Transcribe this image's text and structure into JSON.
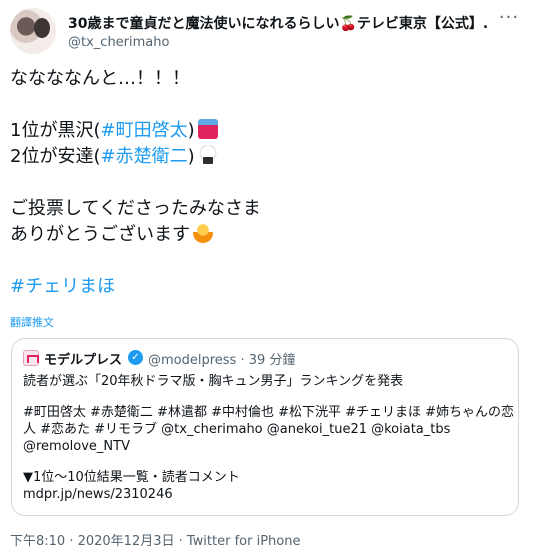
{
  "header": {
    "display_name": "30歳まで童貞だと魔法使いになれるらしい🍒テレビ東京【公式】...",
    "handle": "@tx_cherimaho",
    "more_icon": "more-horizontal-icon"
  },
  "tweet": {
    "line1": "ななななんと…！！！",
    "rank1_prefix": "1位が黒沢(",
    "rank1_hashtag": "#町田啓太",
    "rank1_suffix": ")",
    "rank2_prefix": "2位が安達(",
    "rank2_hashtag": "#赤楚衛二",
    "rank2_suffix": ")",
    "thanks1": "ご投票してくださったみなさま",
    "thanks2": "ありがとうございます",
    "hashtag": "#チェリまほ"
  },
  "translate_label": "翻譯推文",
  "quote": {
    "name": "モデルプレス",
    "meta": "@modelpress · 39 分鐘",
    "title": "読者が選ぶ「20年秋ドラマ版・胸キュン男子」ランキングを発表",
    "tags_line1": "#町田啓太 #赤楚衛二 #林遣都 #中村倫也 #松下洸平 #チェリまほ #姉ちゃんの恋",
    "tags_line2": "人 #恋あた #リモラブ @tx_cherimaho @anekoi_tue21 @koiata_tbs",
    "tags_line3": "@remolove_NTV",
    "results": "▼1位〜10位結果一覧・読者コメント",
    "link": "mdpr.jp/news/2310246"
  },
  "footer": {
    "timestamp": "下午8:10 · 2020年12月3日 · Twitter for iPhone"
  },
  "colors": {
    "accent": "#1d9bf0",
    "text": "#0f1419",
    "muted": "#536471",
    "border": "#cfd9de"
  }
}
